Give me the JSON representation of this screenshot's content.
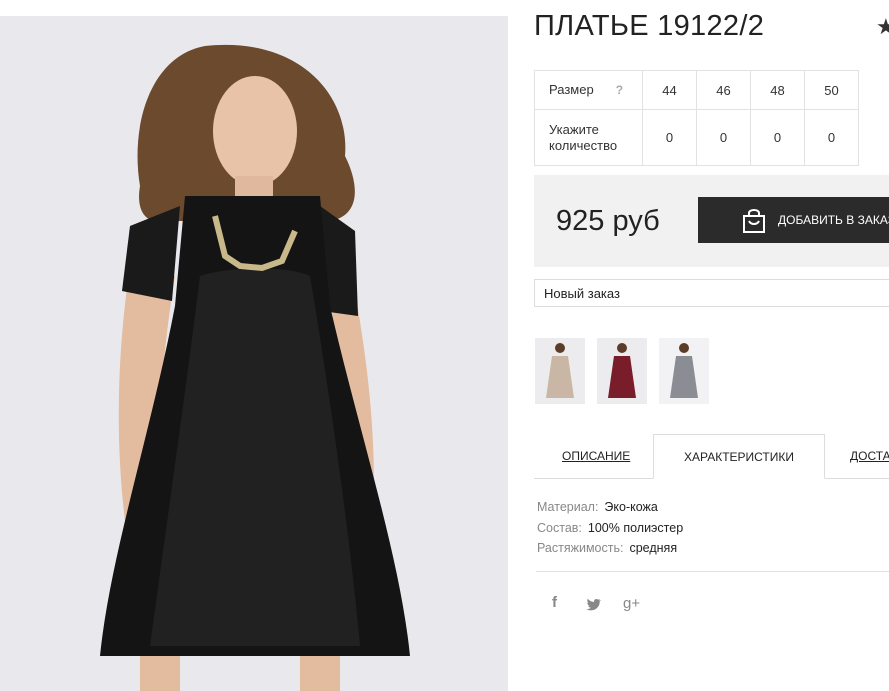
{
  "product": {
    "title": "ПЛАТЬЕ 19122/2",
    "favorite_icon": "star-icon"
  },
  "sizes": {
    "row1_label": "Размер",
    "help_mark": "?",
    "values": [
      "44",
      "46",
      "48",
      "50"
    ],
    "row2_label": "Укажите количество",
    "quantities": [
      "0",
      "0",
      "0",
      "0"
    ]
  },
  "buy": {
    "price": "925 руб",
    "add_label": "ДОБАВИТЬ В ЗАКАЗ",
    "icon": "shopping-bag-icon"
  },
  "order": {
    "selected": "Новый заказ"
  },
  "thumbnails": [
    {
      "name": "beige dress",
      "color": "#c9b6a4"
    },
    {
      "name": "burgundy dress",
      "color": "#7a1d2a"
    },
    {
      "name": "grey dress",
      "color": "#8a8d93"
    }
  ],
  "tabs": [
    {
      "label": "ОПИСАНИЕ"
    },
    {
      "label": "ХАРАКТЕРИСТИКИ",
      "active": true
    },
    {
      "label": "ДОСТАВКА"
    }
  ],
  "characteristics": [
    {
      "key": "Материал:",
      "value": "Эко-кожа"
    },
    {
      "key": "Состав:",
      "value": "100% полиэстер"
    },
    {
      "key": "Растяжимость:",
      "value": "средняя"
    }
  ],
  "social": {
    "facebook": "f",
    "twitter": "twitter-icon",
    "google": "g+"
  },
  "colors": {
    "button": "#2b2b2b",
    "panel": "#f1f1f1",
    "border": "#e2e2e2"
  }
}
